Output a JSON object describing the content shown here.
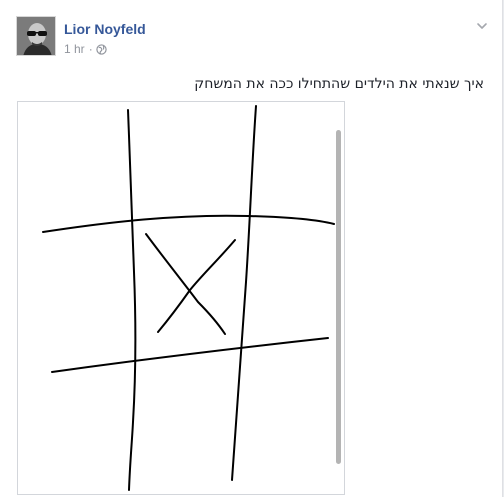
{
  "post": {
    "author_name": "Lior Noyfeld",
    "timestamp": "1 hr",
    "separator": "·",
    "privacy_icon": "globe-icon",
    "menu_icon": "chevron-down-icon",
    "text": "איך שנאתי את הילדים שהתחילו ככה את המשחק"
  },
  "photo": {
    "subject": "hand-drawn tic-tac-toe grid with an X in the center square"
  },
  "colors": {
    "author_link": "#365899",
    "meta_gray": "#90949c",
    "text": "#1d2129",
    "ink": "#000000"
  }
}
